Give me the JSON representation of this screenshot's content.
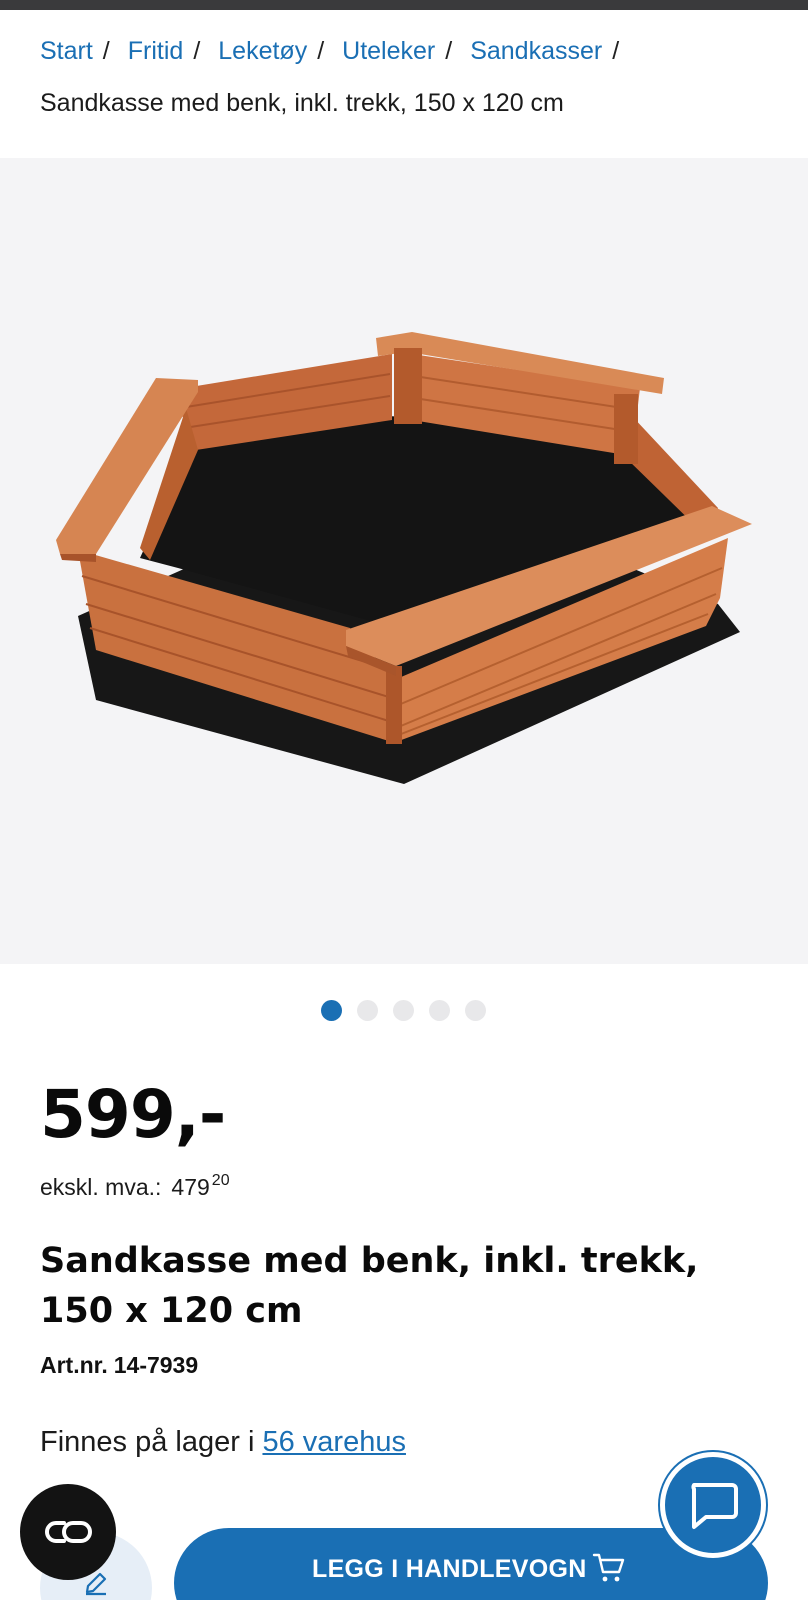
{
  "breadcrumb": {
    "items": [
      "Start",
      "Fritid",
      "Leketøy",
      "Uteleker",
      "Sandkasser"
    ],
    "separator": "/",
    "current": "Sandkasse med benk, inkl. trekk, 150 x 120 cm"
  },
  "gallery": {
    "image_count": 5,
    "active_index": 0
  },
  "product": {
    "price": "599,-",
    "ex_vat_label": "ekskl. mva.:",
    "ex_vat_main": "479",
    "ex_vat_cents": "20",
    "title": "Sandkasse med benk, inkl. trekk, 150 x 120 cm",
    "art_label": "Art.nr.",
    "art_number": "14-7939",
    "stock_prefix": "Finnes på lager i",
    "stock_link": "56 varehus"
  },
  "actions": {
    "cart_label": "LEGG I HANDLEVOGN"
  },
  "colors": {
    "brand_blue": "#1a6fb4",
    "gallery_bg": "#f4f4f6",
    "cookie_bg": "#131313"
  },
  "icons": {
    "cookie": "cookie-settings-icon",
    "chat": "chat-bubble-icon",
    "edit": "pencil-icon",
    "cart": "cart-icon"
  }
}
